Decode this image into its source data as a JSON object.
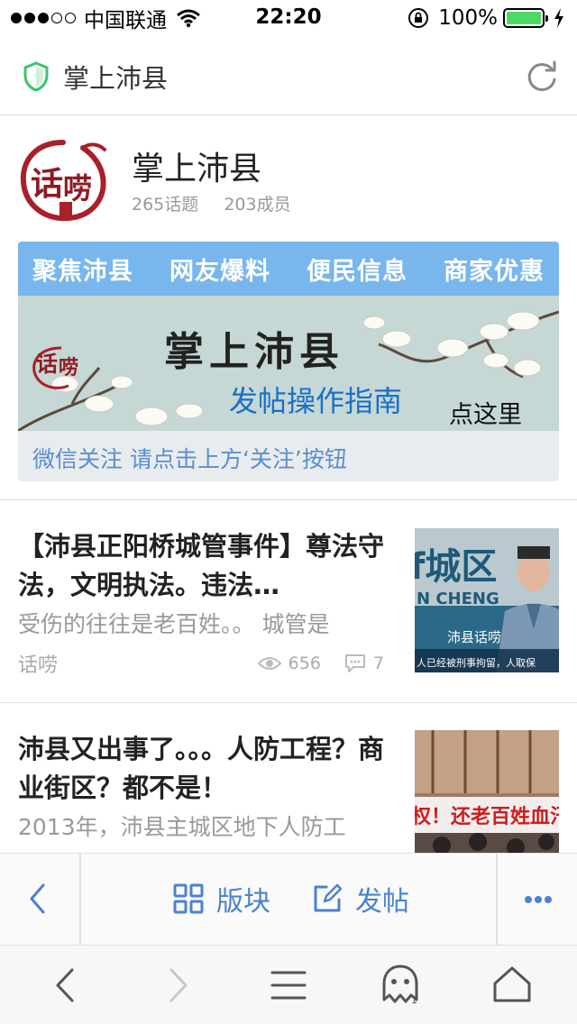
{
  "status": {
    "carrier": "中国联通",
    "time": "22:20",
    "battery": "100%"
  },
  "address_bar": {
    "title": "掌上沛县"
  },
  "forum": {
    "name": "掌上沛县",
    "topics": "265话题",
    "members": "203成员",
    "logo_text": "话唠"
  },
  "banner": {
    "tabs": [
      "聚焦沛县",
      "网友爆料",
      "便民信息",
      "商家优惠"
    ],
    "main_text": "掌上沛县",
    "guide_text": "发帖操作指南",
    "here_text": "点这里",
    "footer": "微信关注 请点击上方‘关注’按钮"
  },
  "posts": [
    {
      "title": "【沛县正阳桥城管事件】尊法守法，文明执法。违法…",
      "summary": "受伤的往往是老百姓。。 城管是",
      "author": "话唠",
      "views": "656",
      "comments": "7",
      "thumb_caption": "人已经被刑事拘留，人取保"
    },
    {
      "title": "沛县又出事了。。。人防工程？商业街区？都不是！",
      "summary": "2013年，沛县主城区地下人防工",
      "thumb_caption": "还老百姓血汗钱"
    }
  ],
  "toolbar": {
    "sections_label": "版块",
    "post_label": "发帖"
  },
  "colors": {
    "accent": "#4a82d4",
    "banner_tabs": "#78b6ee",
    "shield": "#3cc46a",
    "battery": "#4cd964"
  }
}
